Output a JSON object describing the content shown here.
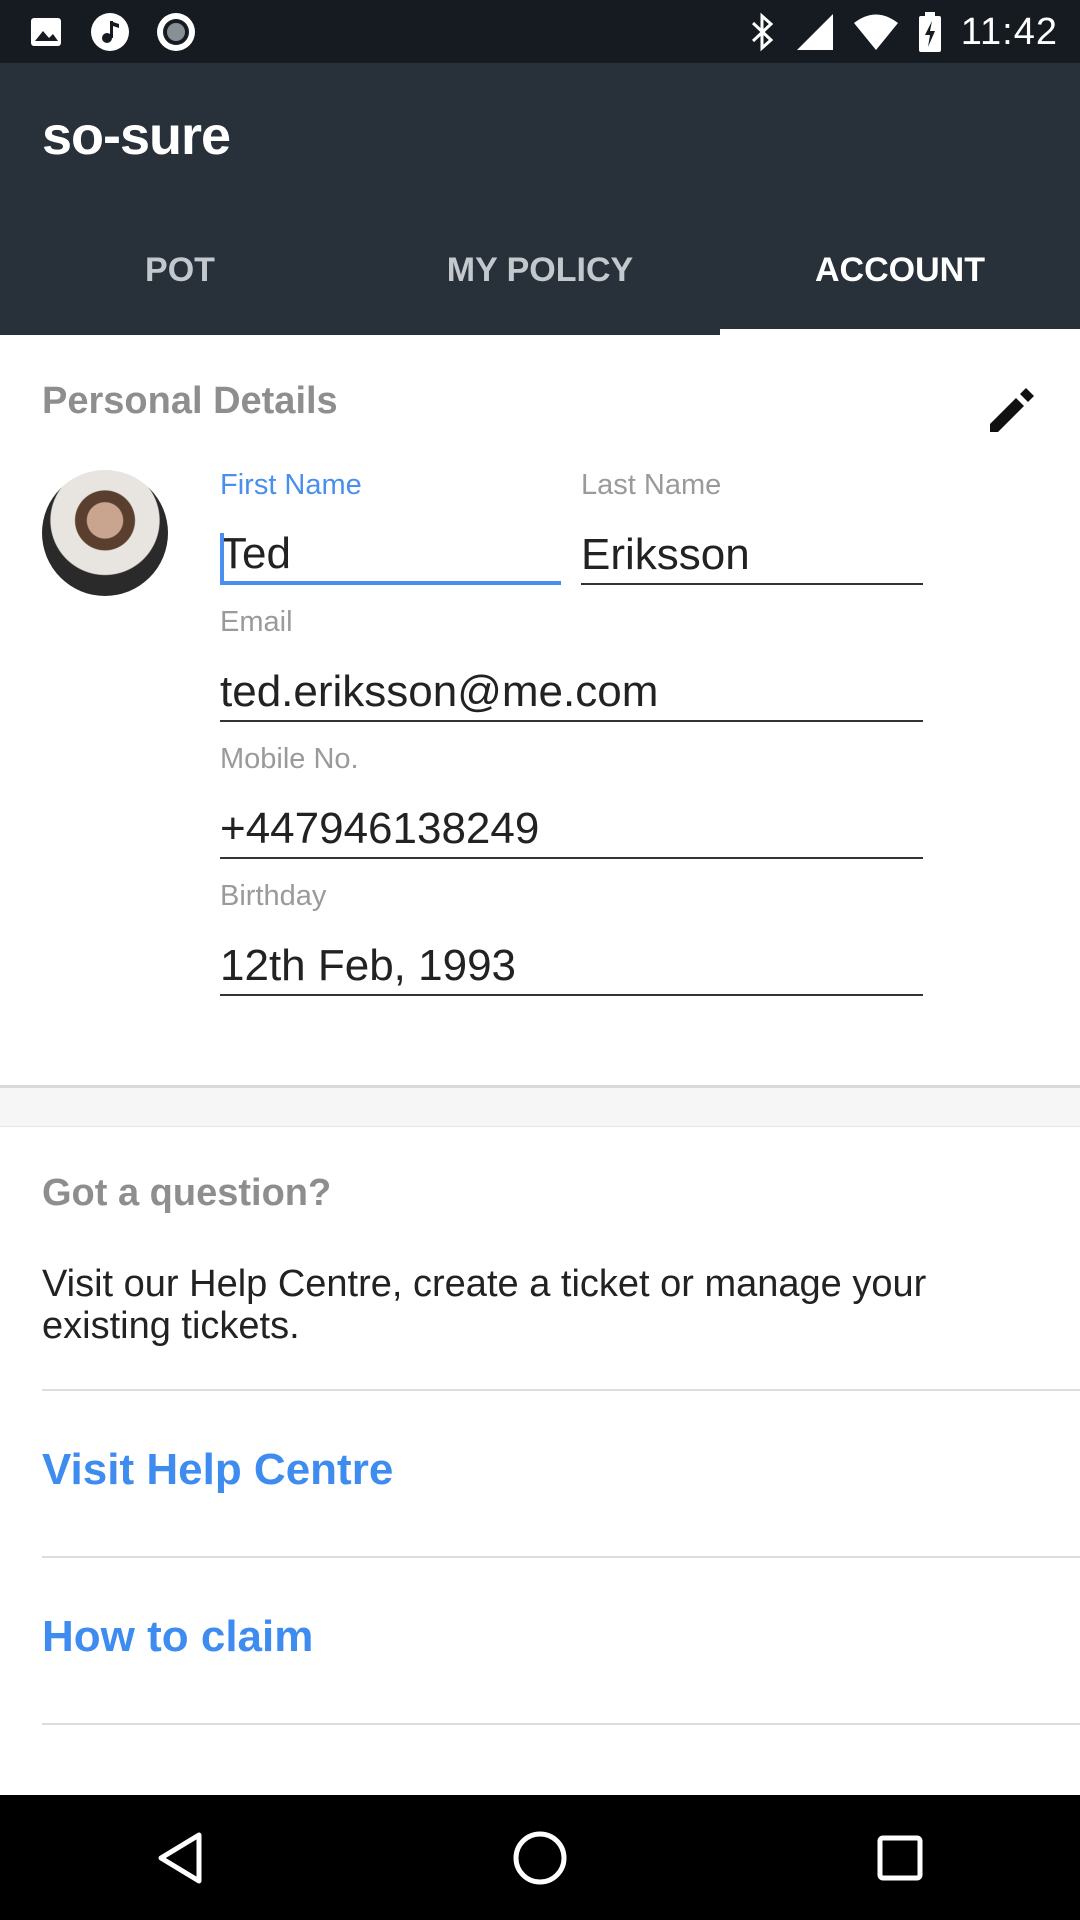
{
  "status_bar": {
    "time": "11:42",
    "icons_left": [
      "image-notification-icon",
      "music-notification-icon",
      "record-notification-icon"
    ],
    "icons_right": [
      "bluetooth-icon",
      "cell-signal-icon",
      "wifi-icon",
      "battery-charging-icon"
    ]
  },
  "app": {
    "logo_text": "so-sure",
    "tabs": [
      {
        "label": "POT",
        "active": false
      },
      {
        "label": "MY POLICY",
        "active": false
      },
      {
        "label": "ACCOUNT",
        "active": true
      }
    ]
  },
  "personal_details": {
    "title": "Personal Details",
    "first_name": {
      "label": "First Name",
      "value": "Ted"
    },
    "last_name": {
      "label": "Last Name",
      "value": "Eriksson"
    },
    "email": {
      "label": "Email",
      "value": "ted.eriksson@me.com"
    },
    "mobile": {
      "label": "Mobile No.",
      "value": "+447946138249"
    },
    "birthday": {
      "label": "Birthday",
      "value": "12th Feb, 1993"
    }
  },
  "help": {
    "title": "Got a question?",
    "description": "Visit our Help Centre, create a ticket or manage your existing tickets.",
    "links": [
      "Visit Help Centre",
      "How to claim"
    ]
  },
  "colors": {
    "status_bar_bg": "#151b20",
    "app_bar_bg": "#28313a",
    "accent_blue": "#4a8ef0",
    "link_blue": "#3f8cf0"
  }
}
